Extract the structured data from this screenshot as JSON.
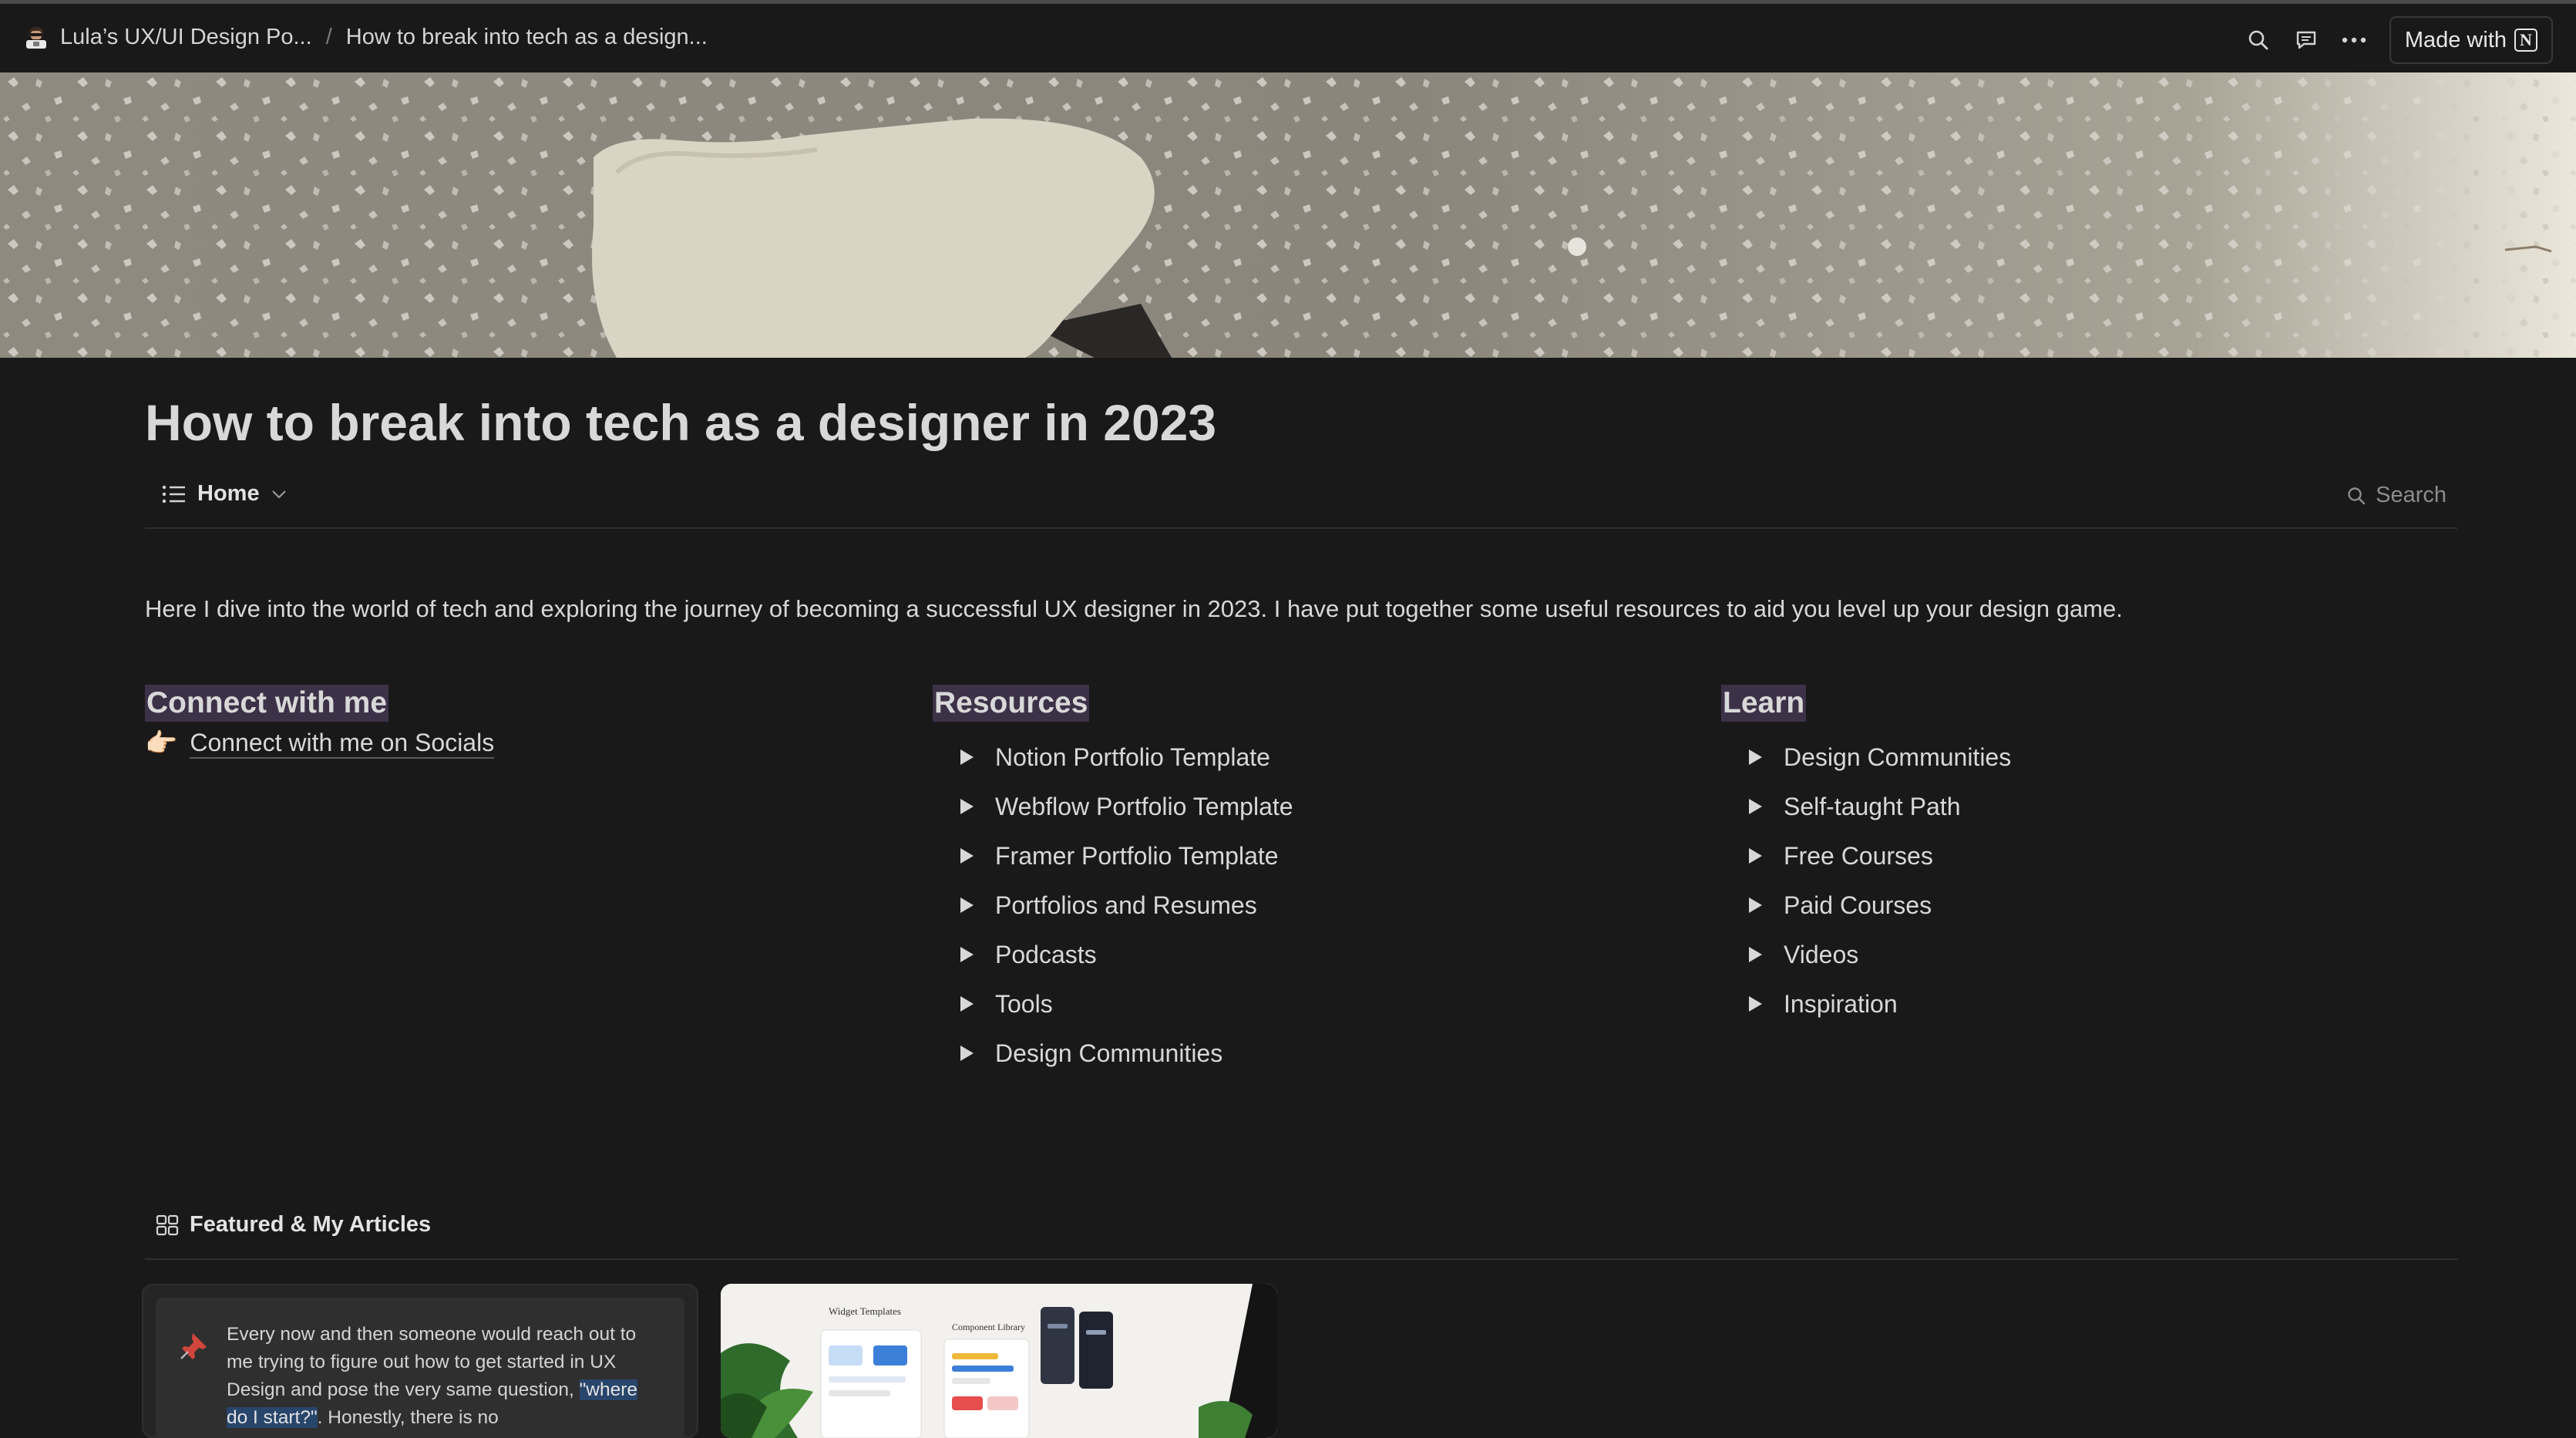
{
  "topbar": {
    "workspace": "Lula’s UX/UI Design Po...",
    "separator": "/",
    "page": "How to break into tech as a design...",
    "made_with_label": "Made with",
    "notion_letter": "N",
    "icons": [
      "search-icon",
      "comment-icon",
      "more-icon"
    ]
  },
  "page": {
    "title": "How to break into tech as a designer in 2023",
    "view_tab": "Home",
    "search_label": "Search",
    "intro": "Here I dive into the world of tech and exploring the journey of becoming a successful UX designer in 2023. I have put together some useful resources to aid you level up your design game."
  },
  "connect": {
    "heading": "Connect with me",
    "emoji": "👉🏻",
    "link": "Connect with me on Socials"
  },
  "resources": {
    "heading": "Resources",
    "items": [
      "Notion Portfolio Template",
      "Webflow Portfolio Template",
      "Framer Portfolio Template",
      "Portfolios and Resumes",
      "Podcasts",
      "Tools",
      "Design Communities"
    ]
  },
  "learn": {
    "heading": "Learn",
    "items": [
      "Design Communities",
      "Self-taught Path",
      "Free Courses",
      "Paid Courses",
      "Videos",
      "Inspiration"
    ]
  },
  "featured": {
    "title": "Featured & My Articles",
    "card1": {
      "text_before": "Every now and then someone would reach out to me trying to figure out how to get started in UX Design and pose the very same question, ",
      "highlight": "\"where do I start?\"",
      "text_after": ". Honestly, there is no"
    },
    "card2": {
      "label_widget": "Widget Templates",
      "label_component": "Component Library"
    }
  },
  "colors": {
    "background": "#191919",
    "heading_highlight": "#3d3148",
    "text_highlight": "#28456c"
  }
}
